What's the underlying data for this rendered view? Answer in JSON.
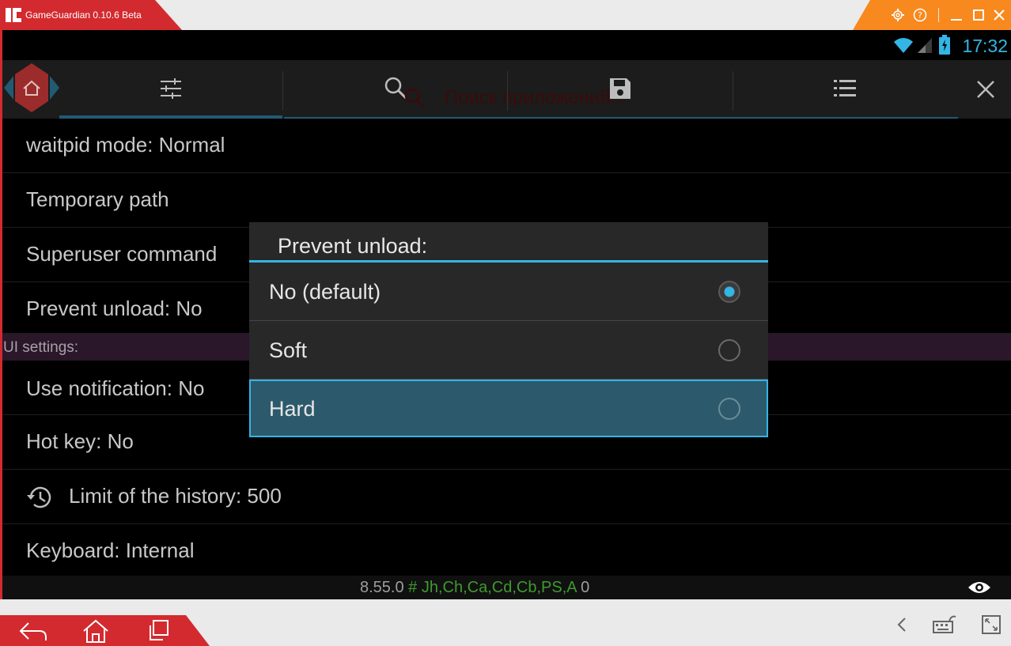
{
  "window": {
    "title": "GameGuardian 0.10.6 Beta"
  },
  "statusbar": {
    "time": "17:32"
  },
  "toolbar": {
    "search_hint": "Поиск приложений..."
  },
  "settings": {
    "rows": [
      {
        "label": "waitpid mode: Normal"
      },
      {
        "label": "Temporary path"
      },
      {
        "label": "Superuser command"
      },
      {
        "label": "Prevent unload: No"
      }
    ],
    "ui_header": "UI settings:",
    "ui_rows": [
      {
        "label": "Use notification: No"
      },
      {
        "label": "Hot key: No"
      },
      {
        "label": "Limit of the history: 500"
      },
      {
        "label": "Keyboard: Internal"
      }
    ]
  },
  "footer": {
    "version": "8.55.0",
    "hash": "#",
    "flags": "Jh,Ch,Ca,Cd,Cb,PS,A",
    "count": "0"
  },
  "dialog": {
    "title": "Prevent unload:",
    "options": [
      {
        "label": "No (default)",
        "checked": true
      },
      {
        "label": "Soft",
        "checked": false
      },
      {
        "label": "Hard",
        "checked": false,
        "highlighted": true
      }
    ]
  },
  "colors": {
    "accent": "#33b5e5",
    "brand_red": "#d32a2f",
    "brand_orange": "#f7891f",
    "tab_indicator": "#225a74",
    "highlight": "#2c5a6c"
  },
  "icons": {
    "app_logo": "gameguardian-logo",
    "settings": "gear-icon",
    "help": "help-icon",
    "minimize": "minimize-icon",
    "maximize": "maximize-icon",
    "close": "close-icon",
    "tools": "sliders-icon",
    "search": "search-icon",
    "save": "save-icon",
    "list": "list-icon",
    "history": "history-icon",
    "eye": "eye-icon",
    "back": "back-icon",
    "home": "home-icon",
    "recents": "recents-icon",
    "keymap": "keyboard-icon",
    "fullscreen": "fullscreen-icon"
  }
}
